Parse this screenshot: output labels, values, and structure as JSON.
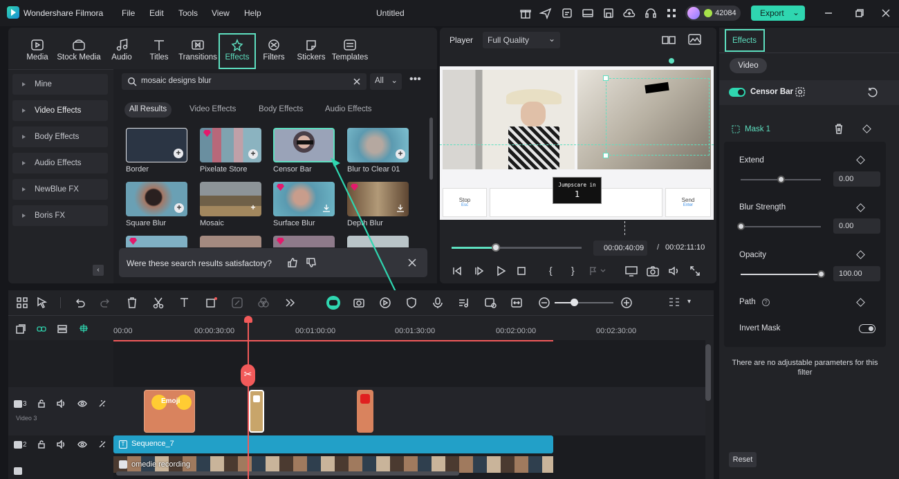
{
  "app": {
    "name": "Wondershare Filmora",
    "doc_title": "Untitled",
    "credits": "42084",
    "export_label": "Export"
  },
  "menu": [
    "File",
    "Edit",
    "Tools",
    "View",
    "Help"
  ],
  "tabs": [
    "Media",
    "Stock Media",
    "Audio",
    "Titles",
    "Transitions",
    "Effects",
    "Filters",
    "Stickers",
    "Templates"
  ],
  "sidebar": [
    "Mine",
    "Video Effects",
    "Body Effects",
    "Audio Effects",
    "NewBlue FX",
    "Boris FX"
  ],
  "search": {
    "value": "mosaic designs blur",
    "filter": "All"
  },
  "chips": [
    "All Results",
    "Video Effects",
    "Body Effects",
    "Audio Effects"
  ],
  "effects": [
    "Border",
    "Pixelate Store",
    "Censor Bar",
    "Blur to Clear 01",
    "Square Blur",
    "Mosaic",
    "Surface Blur",
    "Depth Blur"
  ],
  "feedback": "Were these search results satisfactory?",
  "player": {
    "label": "Player",
    "quality": "Full Quality",
    "current": "00:00:40:09",
    "separator": "/",
    "total": "00:02:11:10",
    "overlay": {
      "jump_title": "Jumpscare in",
      "jump_count": "1",
      "stop": "Stop",
      "stop_key": "Esc",
      "send": "Send",
      "send_key": "Enter"
    },
    "progress": 0.34
  },
  "props": {
    "tab": "Effects",
    "sub": "Video",
    "effect": "Censor Bar",
    "mask": "Mask 1",
    "params": [
      {
        "name": "Extend",
        "value": "0.00",
        "level": 0.5
      },
      {
        "name": "Blur Strength",
        "value": "0.00",
        "level": 0
      },
      {
        "name": "Opacity",
        "value": "100.00",
        "level": 1
      }
    ],
    "path": "Path",
    "invert": "Invert Mask",
    "note": "There are no adjustable parameters for this filter",
    "reset": "Reset"
  },
  "ruler": [
    "00:00",
    "00:00:30:00",
    "00:01:00:00",
    "00:01:30:00",
    "00:02:00:00",
    "00:02:30:00"
  ],
  "tracks": {
    "video3": "Video 3",
    "t3": "3",
    "t2": "2",
    "sequence": "Sequence_7",
    "recording": "omedie recording",
    "emoji_clip": "Emoji"
  },
  "colors": {
    "accent": "#2fd6b0",
    "highlight": "#5ee0c0",
    "playhead": "#f25a5a"
  }
}
